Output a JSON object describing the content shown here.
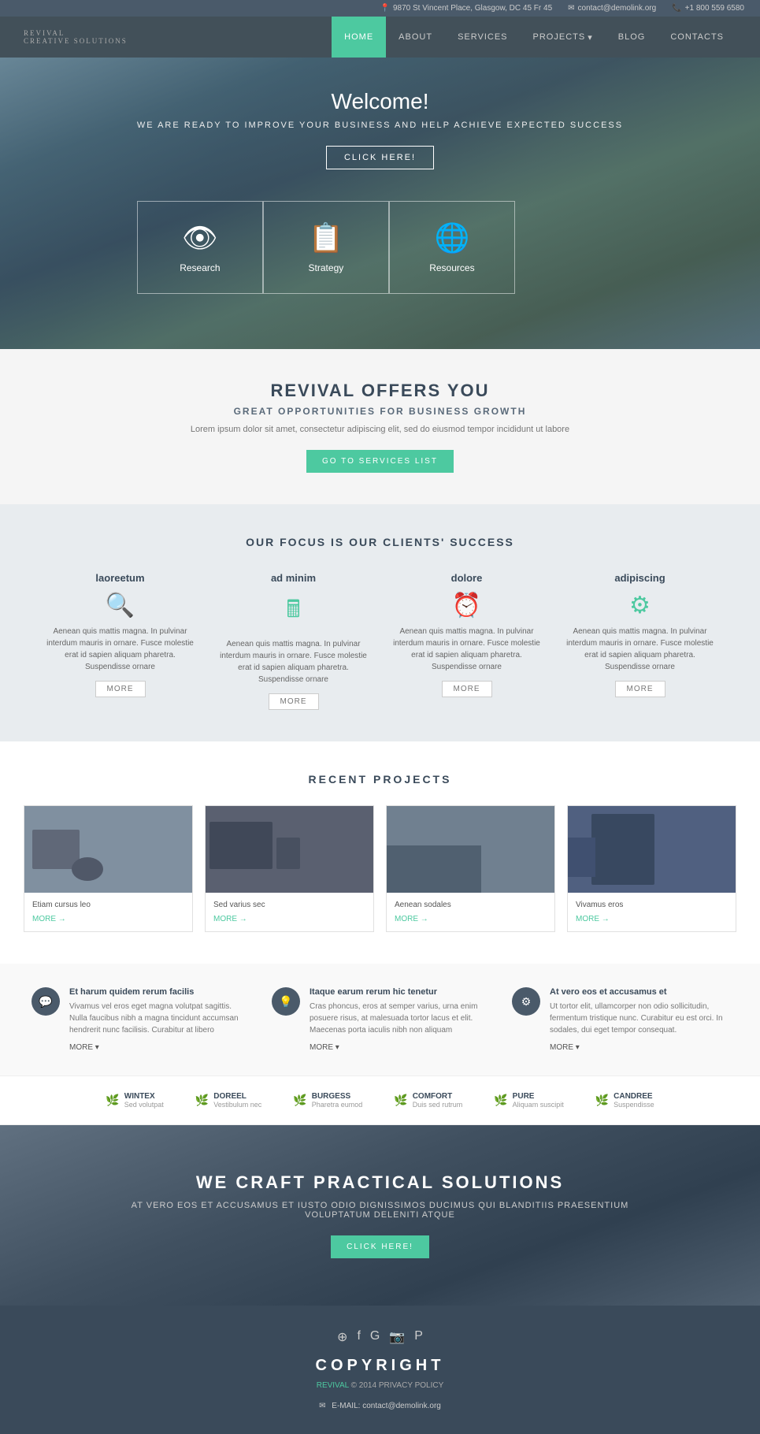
{
  "topbar": {
    "address": "9870 St Vincent Place, Glasgow, DC 45 Fr 45",
    "email": "contact@demolink.org",
    "phone": "+1 800 559 6580"
  },
  "nav": {
    "logo": "Revival",
    "logo_sub": "Creative Solutions",
    "items": [
      {
        "label": "HOME",
        "active": true
      },
      {
        "label": "ABOUT",
        "active": false
      },
      {
        "label": "SERVICES",
        "active": false
      },
      {
        "label": "PROJECTS",
        "active": false
      },
      {
        "label": "BLOG",
        "active": false
      },
      {
        "label": "CONTACTS",
        "active": false
      }
    ]
  },
  "hero": {
    "title": "Welcome!",
    "subtitle": "WE ARE READY TO IMPROVE YOUR BUSINESS AND HELP ACHIEVE EXPECTED SUCCESS",
    "cta_label": "CLICK HERE!",
    "features": [
      {
        "icon": "👁",
        "label": "Research"
      },
      {
        "icon": "📋",
        "label": "Strategy"
      },
      {
        "icon": "🌐",
        "label": "Resources"
      }
    ]
  },
  "offers": {
    "title": "REVIVAL OFFERS YOU",
    "subtitle": "GREAT OPPORTUNITIES FOR BUSINESS GROWTH",
    "body": "Lorem ipsum dolor sit amet, consectetur adipiscing elit, sed do eiusmod tempor incididunt ut labore",
    "cta_label": "GO TO SERVICES LIST"
  },
  "focus": {
    "title": "OUR FOCUS IS OUR CLIENTS' SUCCESS",
    "items": [
      {
        "title": "laoreetum",
        "icon": "🔍",
        "body": "Aenean quis mattis magna. In pulvinar interdum mauris in ornare. Fusce molestie erat id sapien aliquam pharetra. Suspendisse ornare",
        "more": "MORE"
      },
      {
        "title": "ad minim",
        "icon": "🖩",
        "body": "Aenean quis mattis magna. In pulvinar interdum mauris in ornare. Fusce molestie erat id sapien aliquam pharetra. Suspendisse ornare",
        "more": "MORE"
      },
      {
        "title": "dolore",
        "icon": "⏰",
        "body": "Aenean quis mattis magna. In pulvinar interdum mauris in ornare. Fusce molestie erat id sapien aliquam pharetra. Suspendisse ornare",
        "more": "MORE"
      },
      {
        "title": "adipiscing",
        "icon": "⚙",
        "body": "Aenean quis mattis magna. In pulvinar interdum mauris in ornare. Fusce molestie erat id sapien aliquam pharetra. Suspendisse ornare",
        "more": "MORE"
      }
    ]
  },
  "projects": {
    "title": "RECENT PROJECTS",
    "items": [
      {
        "title": "Etiam cursus leo",
        "more": "MORE →"
      },
      {
        "title": "Sed varius sec",
        "more": "MORE →"
      },
      {
        "title": "Aenean sodales",
        "more": "MORE →"
      },
      {
        "title": "Vivamus eros",
        "more": "MORE →"
      }
    ]
  },
  "info_strip": {
    "items": [
      {
        "icon": "💬",
        "title": "Et harum quidem rerum facilis",
        "body": "Vivamus vel eros eget magna volutpat sagittis. Nulla faucibus nibh a magna tincidunt accumsan hendrerit nunc facilisis. Curabitur at libero",
        "more": "MORE ▾"
      },
      {
        "icon": "💡",
        "title": "Itaque earum rerum hic tenetur",
        "body": "Cras phoncus, eros at semper varius, urna enim posuere risus, at malesuada tortor lacus et elit. Maecenas porta iaculis nibh non aliquam",
        "more": "MORE ▾"
      },
      {
        "icon": "⚙",
        "title": "At vero eos et accusamus et",
        "body": "Ut tortor elit, ullamcorper non odio sollicitudin, fermentum tristique nunc. Curabitur eu est orci. In sodales, dui eget tempor consequat.",
        "more": "MORE ▾"
      }
    ]
  },
  "partners": [
    {
      "icon": "🌿",
      "name": "WINTEX",
      "tagline": "Sed volutpat"
    },
    {
      "icon": "🌿",
      "name": "DOREEL",
      "tagline": "Vestibulum nec"
    },
    {
      "icon": "🌿",
      "name": "BURGESS",
      "tagline": "Pharetra eumod"
    },
    {
      "icon": "🌿",
      "name": "COMFORT",
      "tagline": "Duis sed rutrum"
    },
    {
      "icon": "🌿",
      "name": "PURE",
      "tagline": "Aliquam suscipit"
    },
    {
      "icon": "🌿",
      "name": "CANDREE",
      "tagline": "Suspendisse"
    }
  ],
  "cta_banner": {
    "title": "WE CRAFT PRACTICAL SOLUTIONS",
    "subtitle": "AT VERO EOS ET ACCUSAMUS ET IUSTO ODIO DIGNISSIMOS DUCIMUS QUI BLANDITIIS PRAESENTIUM\nVOLUPTATUM DELENITI ATQUE",
    "cta_label": "CLICK HERE!"
  },
  "footer": {
    "social_icons": [
      "RSS",
      "f",
      "G+",
      "📷",
      "P"
    ],
    "copyright": "COPYRIGHT",
    "brand": "REVIVAL",
    "year": "© 2014",
    "privacy": "PRIVACY POLICY",
    "email_label": "E-MAIL:",
    "email": "contact@demolink.org"
  }
}
